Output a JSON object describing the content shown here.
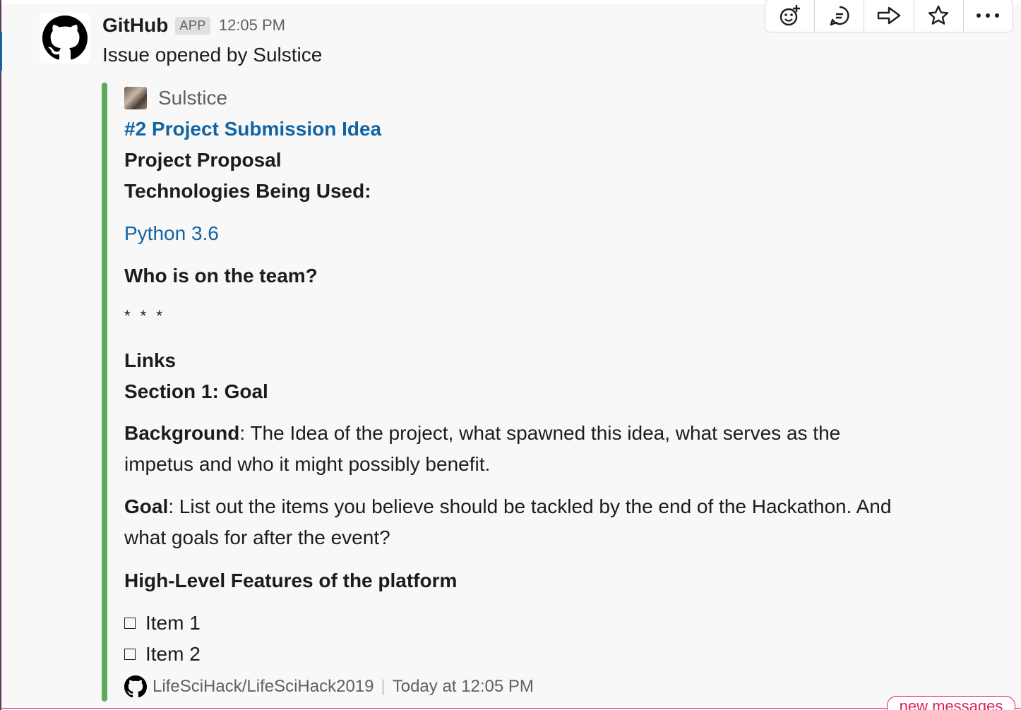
{
  "message": {
    "sender": "GitHub",
    "badge": "APP",
    "time": "12:05 PM",
    "summary": "Issue opened by Sulstice"
  },
  "actions": [
    {
      "name": "add-reaction-icon"
    },
    {
      "name": "reply-thread-icon"
    },
    {
      "name": "share-message-icon"
    },
    {
      "name": "star-icon"
    },
    {
      "name": "more-actions-icon"
    }
  ],
  "attachment": {
    "author": "Sulstice",
    "title": "#2 Project Submission Idea",
    "heading": "Project Proposal",
    "tech_heading": "Technologies Being Used:",
    "tech_link": "Python 3.6",
    "team_heading": "Who is on the team?",
    "separator": "* * *",
    "links_heading": "Links",
    "section_heading": "Section 1: Goal",
    "background_label": "Background",
    "background_text": ": The Idea of the project, what spawned this idea, what serves as the impetus and who it might possibly benefit.",
    "goal_label": "Goal",
    "goal_text": ": List out the items you believe should be tackled by the end of the Hackathon. And what goals for after the event?",
    "features_heading": "High-Level Features of the platform",
    "checklist": [
      "Item 1",
      "Item 2"
    ],
    "footer": {
      "repo": "LifeSciHack/LifeSciHack2019",
      "time": "Today at 12:05 PM"
    }
  },
  "new_messages": "new messages",
  "colors": {
    "link": "#1264a3",
    "attachment_bar": "#5cab5c",
    "new_messages": "#e01e5a"
  }
}
